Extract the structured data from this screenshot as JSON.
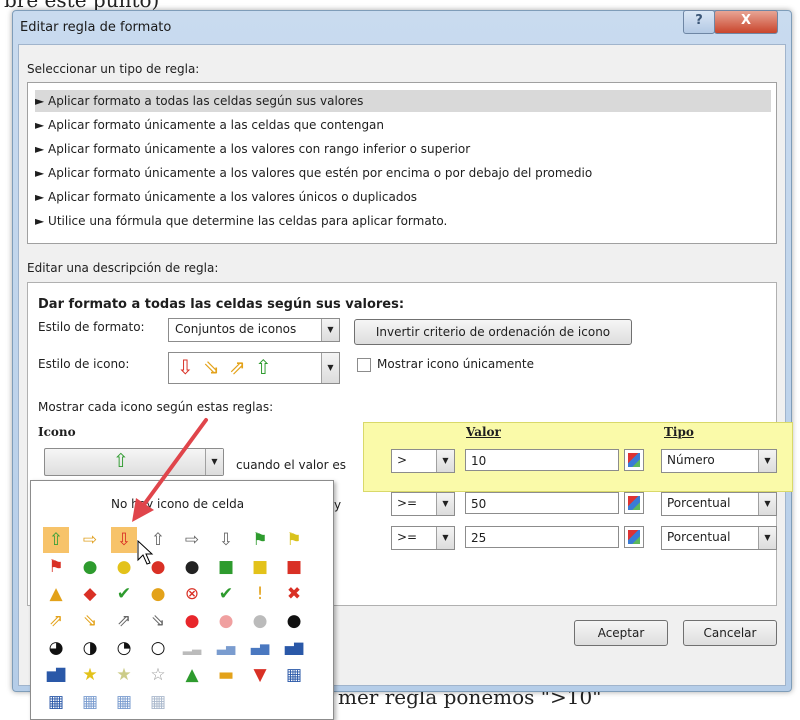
{
  "background": {
    "top_text": "bre este punto)",
    "bottom_text": "mer regla ponemos \">10\""
  },
  "dialog": {
    "title": "Editar regla de formato",
    "help_label": "?",
    "close_label": "X"
  },
  "rule_type": {
    "label": "Seleccionar un tipo de regla:",
    "items": [
      "► Aplicar formato a todas las celdas según sus valores",
      "► Aplicar formato únicamente a las celdas que contengan",
      "► Aplicar formato únicamente a los valores con rango inferior o superior",
      "► Aplicar formato únicamente a los valores que estén por encima o por debajo del promedio",
      "► Aplicar formato únicamente a los valores únicos o duplicados",
      "► Utilice una fórmula que determine las celdas para aplicar formato."
    ]
  },
  "description": {
    "label": "Editar una descripción de regla:",
    "heading": "Dar formato a todas las celdas según sus valores:",
    "format_style_label": "Estilo de formato:",
    "format_style_value": "Conjuntos de iconos",
    "invert_button": "Invertir criterio de ordenación de icono",
    "icon_style_label": "Estilo de icono:",
    "icon_style_icons": [
      "⇩",
      "⇘",
      "⇗",
      "⇧"
    ],
    "show_icon_only_label": "Mostrar icono únicamente",
    "rules_caption": "Mostrar cada icono según estas reglas:",
    "col_icon": "Icono",
    "col_value": "Valor",
    "col_type": "Tipo",
    "rule1_icon": "⇧",
    "rule1_text": "cuando el valor es",
    "rule2_partial": "y",
    "rules": [
      {
        "operator": ">",
        "value": "10",
        "type": "Número"
      },
      {
        "operator": ">=",
        "value": "50",
        "type": "Porcentual"
      },
      {
        "operator": ">=",
        "value": "25",
        "type": "Porcentual"
      }
    ]
  },
  "buttons": {
    "ok": "Aceptar",
    "cancel": "Cancelar"
  },
  "popup": {
    "no_icon": "No hay icono de celda",
    "rows": [
      [
        {
          "g": "⇧",
          "c": "#3aa03a",
          "hl": true
        },
        {
          "g": "⇨",
          "c": "#e0a020"
        },
        {
          "g": "⇩",
          "c": "#d93025",
          "hl": true
        },
        {
          "g": "⇧",
          "c": "#666"
        },
        {
          "g": "⇨",
          "c": "#666"
        },
        {
          "g": "⇩",
          "c": "#666"
        },
        {
          "g": "⚑",
          "c": "#2e9b2e"
        },
        {
          "g": "⚑",
          "c": "#d9c21c"
        }
      ],
      [
        {
          "g": "⚑",
          "c": "#d93025"
        },
        {
          "g": "●",
          "c": "#2e9b2e"
        },
        {
          "g": "●",
          "c": "#e3c21a"
        },
        {
          "g": "●",
          "c": "#d93025"
        },
        {
          "g": "●",
          "c": "#222"
        },
        {
          "g": "■",
          "c": "#2e9b2e"
        },
        {
          "g": "■",
          "c": "#e3c21a"
        },
        {
          "g": "■",
          "c": "#d93025"
        }
      ],
      [
        {
          "g": "▲",
          "c": "#e3a21a"
        },
        {
          "g": "◆",
          "c": "#d93025"
        },
        {
          "g": "✔",
          "c": "#2e9b2e"
        },
        {
          "g": "●",
          "c": "#e3a21a"
        },
        {
          "g": "⊗",
          "c": "#d93025"
        },
        {
          "g": "✔",
          "c": "#2e9b2e"
        },
        {
          "g": "!",
          "c": "#e3a21a"
        },
        {
          "g": "✖",
          "c": "#d93025"
        }
      ],
      [
        {
          "g": "⇗",
          "c": "#e3a21a"
        },
        {
          "g": "⇘",
          "c": "#e3a21a"
        },
        {
          "g": "⇗",
          "c": "#666"
        },
        {
          "g": "⇘",
          "c": "#666"
        },
        {
          "g": "●",
          "c": "#e8262b"
        },
        {
          "g": "●",
          "c": "#f0a0a0"
        },
        {
          "g": "●",
          "c": "#bbbbbb"
        },
        {
          "g": "●",
          "c": "#111"
        }
      ],
      [
        {
          "g": "◕",
          "c": "#111"
        },
        {
          "g": "◑",
          "c": "#111"
        },
        {
          "g": "◔",
          "c": "#111"
        },
        {
          "g": "○",
          "c": "#111"
        },
        {
          "g": "▂▃",
          "c": "#bbbbbb"
        },
        {
          "g": "▃▅",
          "c": "#7a9ccf"
        },
        {
          "g": "▄▆",
          "c": "#4a78c0"
        },
        {
          "g": "▅▇",
          "c": "#2a58a8"
        }
      ],
      [
        {
          "g": "▆█",
          "c": "#2a58a8"
        },
        {
          "g": "★",
          "c": "#e3c21a"
        },
        {
          "g": "★",
          "c": "#cccc88"
        },
        {
          "g": "☆",
          "c": "#999"
        },
        {
          "g": "▲",
          "c": "#2e9b2e"
        },
        {
          "g": "▬",
          "c": "#e3a21a"
        },
        {
          "g": "▼",
          "c": "#d93025"
        },
        {
          "g": "▦",
          "c": "#2a58a8"
        }
      ],
      [
        {
          "g": "▦",
          "c": "#2a58a8"
        },
        {
          "g": "▦",
          "c": "#7a9ccf"
        },
        {
          "g": "▦",
          "c": "#7a9ccf"
        },
        {
          "g": "▦",
          "c": "#aab8cc"
        }
      ]
    ]
  }
}
